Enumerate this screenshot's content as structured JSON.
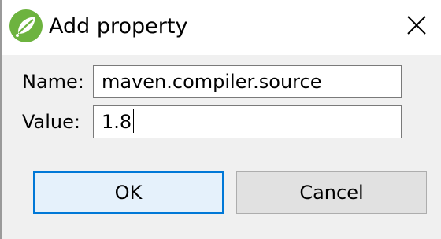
{
  "window": {
    "title": "Add property",
    "icon": "spring-leaf-icon",
    "close_icon": "close-icon"
  },
  "form": {
    "name_label": "Name:",
    "name_value": "maven.compiler.source",
    "value_label": "Value:",
    "value_value": "1.8"
  },
  "buttons": {
    "ok_label": "OK",
    "cancel_label": "Cancel"
  },
  "colors": {
    "spring_green": "#6db33f",
    "focus_blue": "#0078d7"
  }
}
